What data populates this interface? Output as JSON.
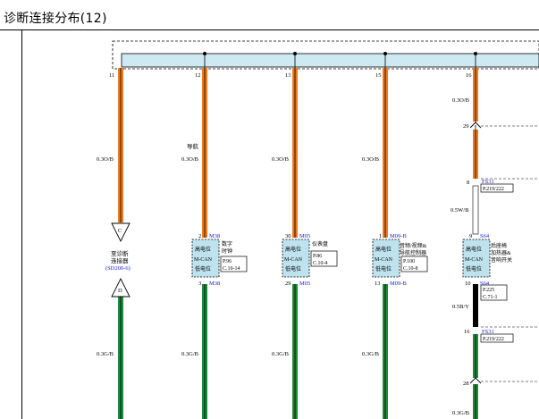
{
  "title": "诊断连接分布(12)",
  "colors": {
    "orange_wire": "#f0791e",
    "green_wire": "#1f8a3a",
    "bus_fill": "#cfe9f3",
    "module_fill": "#bfe3ee",
    "connector_blue": "#1a1ad6"
  },
  "splice_pins": [
    "11",
    "12",
    "13",
    "15",
    "16"
  ],
  "wires": {
    "upper_spec": "0.3O/B",
    "lower_spec": "0.3G/B",
    "w1": "0.5W/B",
    "w2": "0.5B/Y"
  },
  "diag_connector": {
    "top_letter": "C",
    "bottom_letter": "D",
    "label_line1": "至诊断",
    "label_line2": "连接器",
    "label_line3": "(SD200-6)"
  },
  "nav_label": "导航",
  "modules": [
    {
      "pin_top": "2",
      "conn_top": "M38",
      "pin_bot": "3",
      "conn_bot": "M38",
      "high": "高电位",
      "can": "M-CAN",
      "low": "低电位",
      "name": [
        "数字",
        "时钟"
      ],
      "refs": [
        "P.96",
        "C.10-14"
      ]
    },
    {
      "pin_top": "30",
      "conn_top": "M05",
      "pin_bot": "29",
      "conn_bot": "M05",
      "high": "高电位",
      "can": "M-CAN",
      "low": "低电位",
      "name": [
        "仪表盘"
      ],
      "refs": [
        "P.86",
        "C.10-4"
      ]
    },
    {
      "pin_top": "1",
      "conn_top": "M09-B",
      "pin_bot": "13",
      "conn_bot": "M09-B",
      "high": "高电位",
      "can": "M-CAN",
      "low": "低电位",
      "name": [
        "音频/视频&",
        "导航控制器"
      ],
      "refs": [
        "P.100",
        "C.10-8"
      ]
    },
    {
      "pin_top": "9",
      "conn_top": "S64",
      "pin_bot": "10",
      "conn_bot": "S64",
      "high": "高电位",
      "can": "M-CAN",
      "low": "低电位",
      "name": [
        "后座椅",
        "加热器&",
        "音响开关"
      ],
      "refs": [
        "P.225",
        "C.71-1"
      ]
    }
  ],
  "right_branch": {
    "pin_29": "29",
    "pin_8": "8",
    "fs_top": "FS31",
    "fs_top_ref": "P.219/222",
    "pin_16": "16",
    "fs_bot": "FS31",
    "fs_bot_ref": "P.219/222",
    "pin_28": "28"
  }
}
